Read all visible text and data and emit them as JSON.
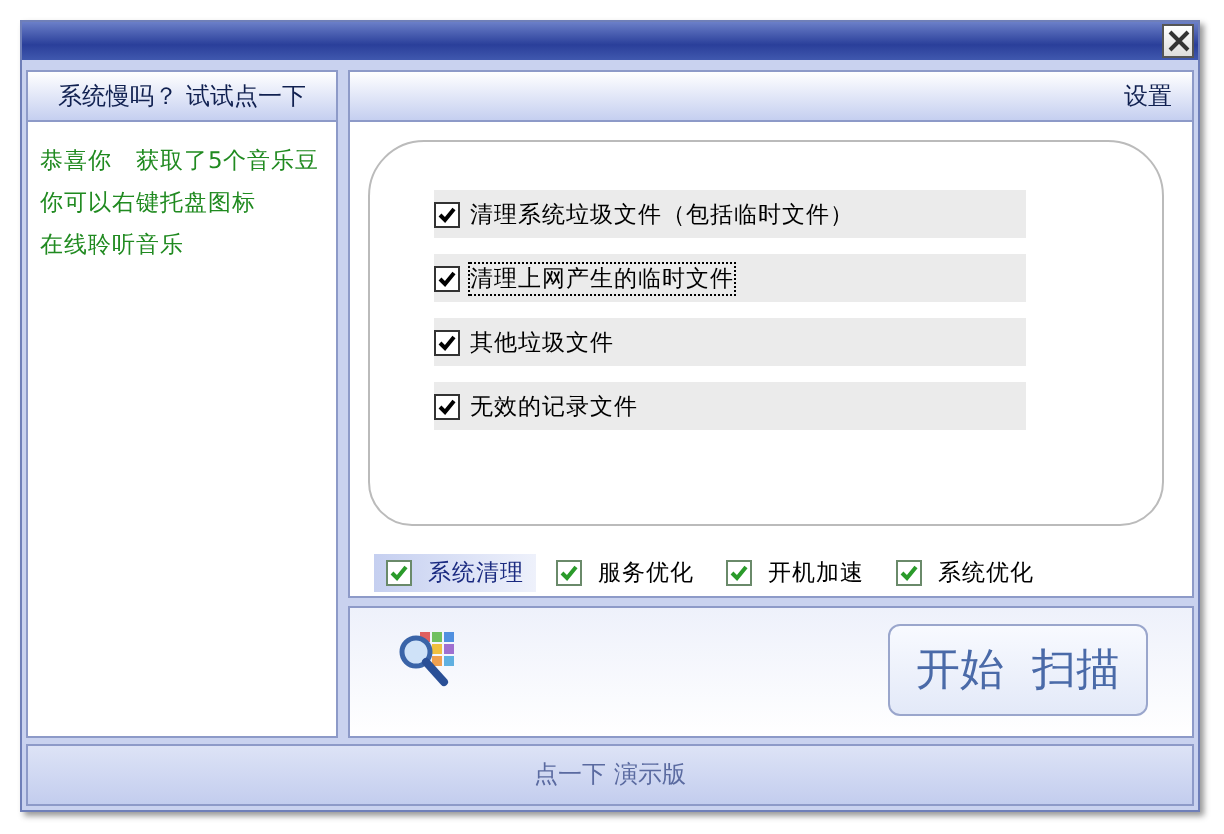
{
  "left_panel": {
    "header": "系统慢吗？ 试试点一下",
    "messages": [
      "恭喜你　获取了5个音乐豆",
      "你可以右键托盘图标",
      "在线聆听音乐"
    ]
  },
  "right_panel": {
    "header": "设置",
    "options": [
      {
        "label": "清理系统垃圾文件（包括临时文件）",
        "checked": true,
        "focused": false
      },
      {
        "label": "清理上网产生的临时文件",
        "checked": true,
        "focused": true
      },
      {
        "label": "其他垃圾文件",
        "checked": true,
        "focused": false
      },
      {
        "label": "无效的记录文件",
        "checked": true,
        "focused": false
      }
    ],
    "tabs": [
      {
        "label": "系统清理",
        "checked": true,
        "selected": true
      },
      {
        "label": "服务优化",
        "checked": true,
        "selected": false
      },
      {
        "label": "开机加速",
        "checked": true,
        "selected": false
      },
      {
        "label": "系统优化",
        "checked": true,
        "selected": false
      }
    ],
    "scan_button": "开始  扫描"
  },
  "footer": "点一下 演示版"
}
